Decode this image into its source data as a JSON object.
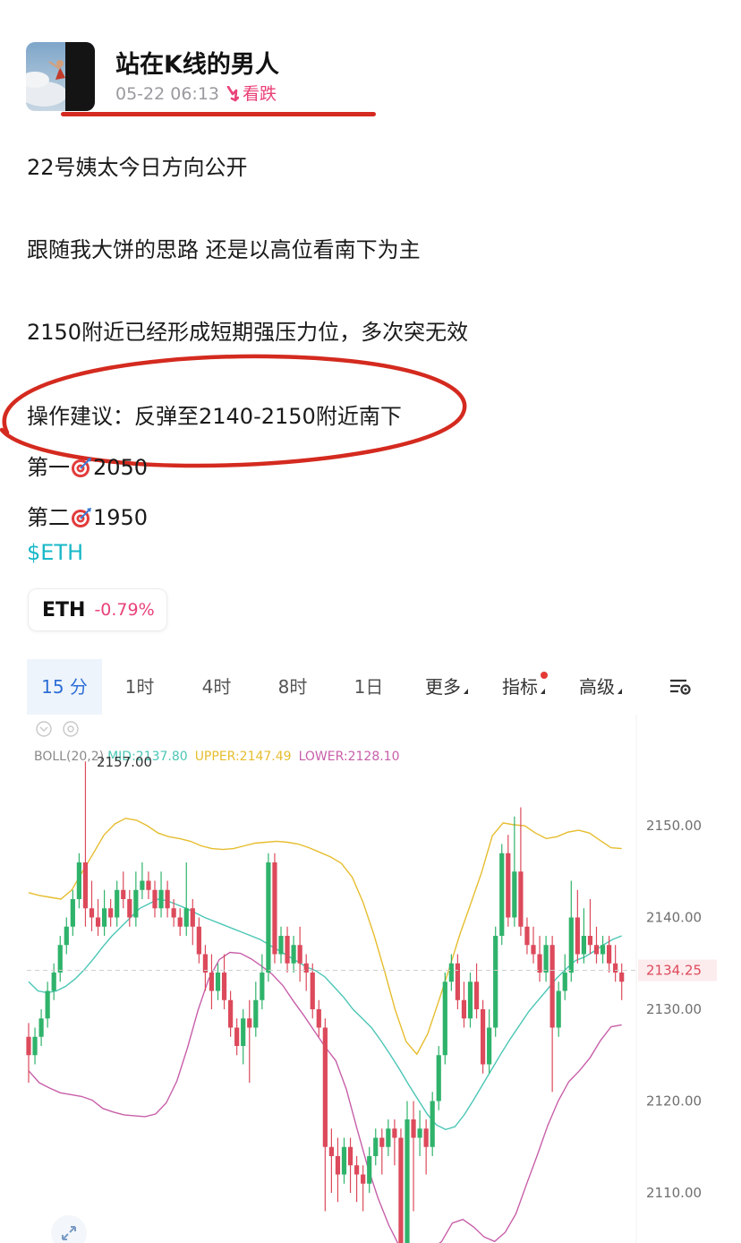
{
  "post": {
    "author": "站在K线的男人",
    "timestamp": "05-22 06:13",
    "signal": "看跌",
    "lines": [
      "22号姨太今日方向公开",
      "跟随我大饼的思路 还是以高位看南下为主",
      "2150附近已经形成短期强压力位，多次突无效",
      "操作建议：反弹至2140-2150附近南下"
    ],
    "target1": {
      "label": "第一",
      "value": "2050"
    },
    "target2": {
      "label": "第二",
      "value": "1950"
    },
    "hashtag": "$ETH"
  },
  "ticker": {
    "symbol": "ETH",
    "change": "-0.79%"
  },
  "tabs": [
    {
      "label": "15 分",
      "active": true
    },
    {
      "label": "1时"
    },
    {
      "label": "4时"
    },
    {
      "label": "8时"
    },
    {
      "label": "1日"
    },
    {
      "label": "更多",
      "dropdown": true
    },
    {
      "label": "指标",
      "dropdown": true,
      "dot": true
    },
    {
      "label": "高级",
      "dropdown": true
    }
  ],
  "colors": {
    "up": "#2fb36b",
    "down": "#dc4a5b",
    "mid": "#4bc6b5",
    "upper": "#e6bd2f",
    "lower": "#c75fa9",
    "accent": "#e94277",
    "link": "#19b8c8"
  },
  "chart_data": {
    "type": "candlestick",
    "indicator": {
      "name": "BOLL(20,2)",
      "mid_label": "MID:2137.80",
      "upper_label": "UPPER:2147.49",
      "lower_label": "LOWER:2128.10"
    },
    "high_marker": "2157.00",
    "last_price": "2134.25",
    "y_ticks": [
      "2150.00",
      "2140.00",
      "2130.00",
      "2120.00",
      "2110.00"
    ],
    "ylim": [
      2104,
      2160
    ],
    "candles": [
      [
        2127,
        2125,
        2128.5,
        2122
      ],
      [
        2125,
        2127,
        2128,
        2124
      ],
      [
        2127,
        2129,
        2130,
        2126
      ],
      [
        2129,
        2132,
        2133,
        2128
      ],
      [
        2132,
        2134,
        2135,
        2131
      ],
      [
        2134,
        2137,
        2138,
        2133
      ],
      [
        2137,
        2139,
        2140,
        2136
      ],
      [
        2139,
        2142,
        2143,
        2138
      ],
      [
        2142,
        2146,
        2147,
        2141
      ],
      [
        2146,
        2141,
        2157,
        2139
      ],
      [
        2141,
        2140,
        2144,
        2138.5
      ],
      [
        2140,
        2139,
        2142,
        2138
      ],
      [
        2139,
        2141,
        2143,
        2138
      ],
      [
        2141,
        2140,
        2142,
        2139
      ],
      [
        2140,
        2143,
        2144,
        2139
      ],
      [
        2143,
        2142,
        2145,
        2141
      ],
      [
        2142,
        2140,
        2143,
        2139
      ],
      [
        2140,
        2143,
        2145,
        2139
      ],
      [
        2143,
        2144,
        2146,
        2142
      ],
      [
        2144,
        2143,
        2145,
        2142
      ],
      [
        2143,
        2141,
        2144,
        2140
      ],
      [
        2141,
        2143,
        2145,
        2140
      ],
      [
        2143,
        2141,
        2144,
        2140
      ],
      [
        2141,
        2140,
        2142,
        2139
      ],
      [
        2140,
        2139,
        2141,
        2138
      ],
      [
        2139,
        2141,
        2146,
        2138
      ],
      [
        2141,
        2139,
        2142,
        2137
      ],
      [
        2139,
        2136,
        2140,
        2135
      ],
      [
        2136,
        2134,
        2137,
        2132
      ],
      [
        2134,
        2132,
        2136,
        2130
      ],
      [
        2132,
        2134,
        2135,
        2131
      ],
      [
        2134,
        2131,
        2136,
        2130
      ],
      [
        2131,
        2128,
        2132,
        2127
      ],
      [
        2128,
        2126,
        2129,
        2125
      ],
      [
        2126,
        2129,
        2130,
        2124
      ],
      [
        2129,
        2128,
        2131,
        2122
      ],
      [
        2128,
        2131,
        2133,
        2127
      ],
      [
        2131,
        2134,
        2136,
        2130
      ],
      [
        2134,
        2146,
        2147,
        2133
      ],
      [
        2146,
        2136,
        2147,
        2135
      ],
      [
        2136,
        2138,
        2139,
        2135
      ],
      [
        2138,
        2135,
        2139,
        2134
      ],
      [
        2135,
        2137,
        2138,
        2134
      ],
      [
        2137,
        2135,
        2139,
        2133
      ],
      [
        2135,
        2134,
        2136,
        2132
      ],
      [
        2134,
        2130,
        2135,
        2129
      ],
      [
        2130,
        2128,
        2131,
        2127
      ],
      [
        2128,
        2115,
        2129,
        2108
      ],
      [
        2115,
        2114,
        2117,
        2110
      ],
      [
        2114,
        2112,
        2116,
        2109
      ],
      [
        2112,
        2115,
        2116,
        2111
      ],
      [
        2115,
        2113,
        2116,
        2110
      ],
      [
        2113,
        2112,
        2114,
        2109
      ],
      [
        2112,
        2111,
        2113,
        2108
      ],
      [
        2111,
        2114,
        2115,
        2110
      ],
      [
        2114,
        2116,
        2117,
        2113
      ],
      [
        2116,
        2115,
        2117,
        2112
      ],
      [
        2115,
        2117,
        2118,
        2114
      ],
      [
        2117,
        2116,
        2118,
        2113
      ],
      [
        2116,
        2104,
        2117,
        2103
      ],
      [
        2104,
        2118,
        2120,
        2103
      ],
      [
        2118,
        2116,
        2120,
        2108
      ],
      [
        2116,
        2117,
        2119,
        2114
      ],
      [
        2117,
        2115,
        2118,
        2112
      ],
      [
        2115,
        2120,
        2121,
        2114
      ],
      [
        2120,
        2125,
        2126,
        2119
      ],
      [
        2125,
        2133,
        2134,
        2124
      ],
      [
        2133,
        2135,
        2136,
        2132
      ],
      [
        2135,
        2131,
        2136,
        2130
      ],
      [
        2131,
        2129,
        2133,
        2128
      ],
      [
        2129,
        2133,
        2134,
        2128
      ],
      [
        2133,
        2130,
        2135,
        2129
      ],
      [
        2130,
        2124,
        2131,
        2123
      ],
      [
        2124,
        2128,
        2130,
        2123
      ],
      [
        2128,
        2138,
        2139,
        2127
      ],
      [
        2138,
        2147,
        2148,
        2137
      ],
      [
        2147,
        2140,
        2149,
        2139
      ],
      [
        2140,
        2145,
        2151,
        2139
      ],
      [
        2145,
        2139,
        2152,
        2138
      ],
      [
        2139,
        2137,
        2140,
        2136
      ],
      [
        2137,
        2136,
        2139,
        2135
      ],
      [
        2136,
        2134,
        2138,
        2133
      ],
      [
        2134,
        2137,
        2138,
        2133
      ],
      [
        2137,
        2128,
        2138,
        2121
      ],
      [
        2128,
        2132,
        2133,
        2127
      ],
      [
        2132,
        2134,
        2136,
        2131
      ],
      [
        2134,
        2140,
        2144,
        2133
      ],
      [
        2140,
        2136,
        2143,
        2135
      ],
      [
        2136,
        2138,
        2141,
        2135
      ],
      [
        2138,
        2137,
        2142,
        2136
      ],
      [
        2137,
        2136,
        2139,
        2135
      ],
      [
        2136,
        2137,
        2138,
        2135
      ],
      [
        2137,
        2135,
        2138,
        2134
      ],
      [
        2135,
        2134,
        2137,
        2133
      ],
      [
        2134,
        2133,
        2135,
        2131
      ]
    ],
    "boll_mid": [
      2133,
      2132,
      2131.8,
      2132,
      2132.5,
      2133.3,
      2134.3,
      2135.5,
      2136.8,
      2138,
      2139,
      2140,
      2141,
      2141.5,
      2142,
      2141.8,
      2141.4,
      2141,
      2140.5,
      2140,
      2139.6,
      2139.2,
      2138.8,
      2138.4,
      2138,
      2137.6,
      2137,
      2136.4,
      2135.8,
      2135.2,
      2134.6,
      2134.2,
      2133.5,
      2132.4,
      2131.3,
      2130,
      2129,
      2128,
      2126.6,
      2125.1,
      2123.5,
      2121.8,
      2120.2,
      2118.6,
      2117.4,
      2116.9,
      2117.2,
      2118.5,
      2120.1,
      2121.8,
      2123.5,
      2125.2,
      2126.8,
      2128.3,
      2129.8,
      2131,
      2132.2,
      2133.4,
      2134.4,
      2135.3,
      2135.7,
      2136.3,
      2137,
      2137.6,
      2138
    ],
    "boll_upper": [
      2142.7,
      2142.4,
      2142.2,
      2142,
      2143,
      2145,
      2147,
      2149,
      2150.2,
      2150.8,
      2150.6,
      2150,
      2149.2,
      2148.8,
      2148.6,
      2148.3,
      2147.8,
      2147.5,
      2147.4,
      2147.5,
      2147.8,
      2148.1,
      2148.2,
      2148.3,
      2148.2,
      2148,
      2147.6,
      2147.1,
      2146.6,
      2145.9,
      2144.4,
      2141.7,
      2138.2,
      2134.2,
      2129.9,
      2126.5,
      2125.1,
      2127.3,
      2130.8,
      2134.4,
      2138.2,
      2141.5,
      2144.9,
      2148.9,
      2150.3,
      2150.1,
      2150,
      2149.2,
      2148.6,
      2148.8,
      2149.3,
      2149.5,
      2149.2,
      2148.4,
      2147.6,
      2147.5
    ],
    "boll_lower": [
      2123.3,
      2122,
      2121.4,
      2120.9,
      2120.7,
      2120.5,
      2120.1,
      2119.2,
      2118.8,
      2118.5,
      2118.4,
      2118.3,
      2118.6,
      2119.8,
      2122.2,
      2125.8,
      2129.9,
      2133.3,
      2135.4,
      2136.2,
      2136.1,
      2135.5,
      2134.7,
      2133.8,
      2132.6,
      2130.9,
      2129.3,
      2127.6,
      2125.9,
      2124.4,
      2121.3,
      2117,
      2112.9,
      2109.4,
      2106.5,
      2104.2,
      2103.3,
      2103.5,
      2103.8,
      2104.7,
      2106.7,
      2107.1,
      2106.3,
      2105.2,
      2104.7,
      2105.7,
      2107.7,
      2110.9,
      2114,
      2117.3,
      2120,
      2122.1,
      2123.3,
      2124.7,
      2126.6,
      2128.1,
      2128.3
    ]
  }
}
